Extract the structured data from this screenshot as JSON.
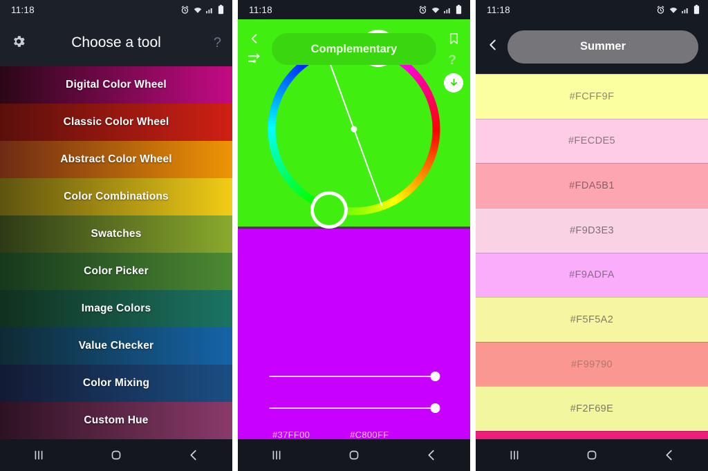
{
  "statusbar": {
    "time": "11:18",
    "icons": [
      "alarm-icon",
      "wifi-icon",
      "signal-icon",
      "battery-icon"
    ]
  },
  "navbar": {
    "recents_label": "|||",
    "home_label": "home-icon",
    "back_label": "back-icon"
  },
  "panel1": {
    "title": "Choose a tool",
    "gear_icon": "gear-icon",
    "help_label": "?",
    "items": [
      {
        "label": "Digital Color Wheel",
        "from": "#2b0716",
        "to": "#c40a85"
      },
      {
        "label": "Classic Color Wheel",
        "from": "#5a0f0b",
        "to": "#d02014"
      },
      {
        "label": "Abstract Color Wheel",
        "from": "#6e2a14",
        "to": "#ef9405"
      },
      {
        "label": "Color Combinations",
        "from": "#5e5410",
        "to": "#f2cc16"
      },
      {
        "label": "Swatches",
        "from": "#2d3a16",
        "to": "#8aaa2c"
      },
      {
        "label": "Color Picker",
        "from": "#16381c",
        "to": "#4d8a33"
      },
      {
        "label": "Image Colors",
        "from": "#11301e",
        "to": "#1b7464"
      },
      {
        "label": "Value Checker",
        "from": "#0f2a33",
        "to": "#1564a8"
      },
      {
        "label": "Color Mixing",
        "from": "#131a33",
        "to": "#1b4e84"
      },
      {
        "label": "Custom Hue",
        "from": "#2d1222",
        "to": "#8a3a6a"
      }
    ]
  },
  "panel2": {
    "scheme_label": "Complementary",
    "back_icon": "back-icon",
    "tune_icon": "tune-icon",
    "bookmark_icon": "bookmark-icon",
    "help_label": "?",
    "download_icon": "download-icon",
    "top_color": "#40EF10",
    "bottom_color": "#C800FF",
    "handles": [
      {
        "name": "handle-primary",
        "color": "#C800FF",
        "angle_deg": 18
      },
      {
        "name": "handle-secondary",
        "color": "#40EF10",
        "angle_deg": 198
      }
    ],
    "sliders": [
      {
        "name": "slider-saturation",
        "value": 100
      },
      {
        "name": "slider-brightness",
        "value": 100
      }
    ],
    "hex_values": [
      "#37FF00",
      "#C800FF"
    ]
  },
  "panel3": {
    "title": "Summer",
    "back_icon": "back-icon",
    "swatches": [
      {
        "hex": "#FCFF9F",
        "text_color": "#8a8a6e"
      },
      {
        "hex": "#FECDE5",
        "text_color": "#8a7481"
      },
      {
        "hex": "#FDA5B1",
        "text_color": "#8a6167"
      },
      {
        "hex": "#F9D3E3",
        "text_color": "#7e6e77"
      },
      {
        "hex": "#F9ADFA",
        "text_color": "#8a6a8a"
      },
      {
        "hex": "#F5F5A2",
        "text_color": "#7e7e62"
      },
      {
        "hex": "#F99790",
        "text_color": "#b5766f"
      },
      {
        "hex": "#F2F69E",
        "text_color": "#7a7c5e"
      }
    ],
    "trailing_color": "#ED1E79"
  }
}
